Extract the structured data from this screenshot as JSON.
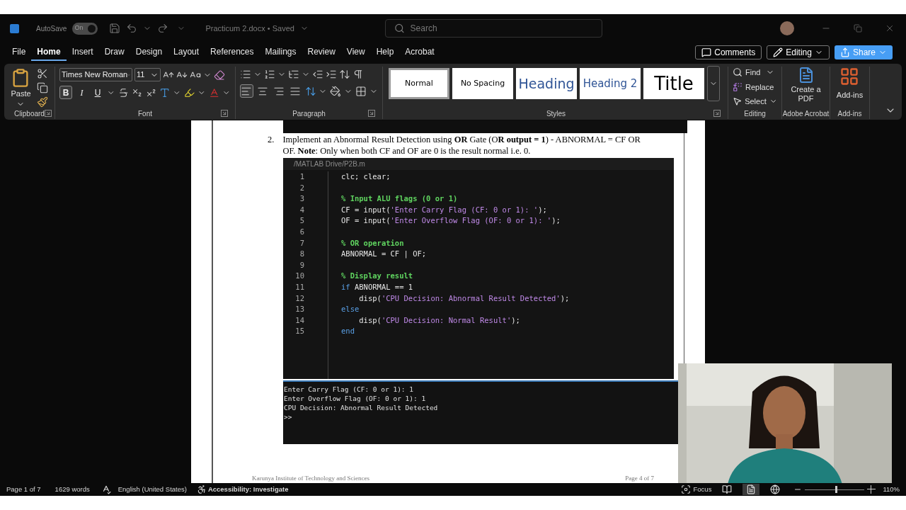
{
  "title_bar": {
    "autosave_label": "AutoSave",
    "autosave_on": true,
    "autosave_state": "On",
    "document_title": "Practicum 2.docx • Saved",
    "search_placeholder": "Search"
  },
  "tabs": [
    {
      "label": "File",
      "selected": false
    },
    {
      "label": "Home",
      "selected": true
    },
    {
      "label": "Insert",
      "selected": false
    },
    {
      "label": "Draw",
      "selected": false
    },
    {
      "label": "Design",
      "selected": false
    },
    {
      "label": "Layout",
      "selected": false
    },
    {
      "label": "References",
      "selected": false
    },
    {
      "label": "Mailings",
      "selected": false
    },
    {
      "label": "Review",
      "selected": false
    },
    {
      "label": "View",
      "selected": false
    },
    {
      "label": "Help",
      "selected": false
    },
    {
      "label": "Acrobat",
      "selected": false
    }
  ],
  "header_buttons": {
    "comments": "Comments",
    "editing": "Editing",
    "share": "Share"
  },
  "ribbon": {
    "clipboard": {
      "paste": "Paste",
      "label": "Clipboard"
    },
    "font": {
      "name": "Times New Roman",
      "size": "11",
      "label": "Font",
      "format": [
        {
          "label": "B",
          "selected": true
        },
        {
          "label": "I",
          "selected": false
        },
        {
          "label": "U",
          "selected": false
        }
      ]
    },
    "paragraph": {
      "label": "Paragraph",
      "alignment": [
        {
          "selected": true
        },
        {
          "selected": false
        },
        {
          "selected": false
        },
        {
          "selected": false
        }
      ]
    },
    "styles": {
      "label": "Styles",
      "items": [
        {
          "label": "Normal",
          "kind": "normal",
          "selected": true
        },
        {
          "label": "No Spacing",
          "kind": "normal",
          "selected": false
        },
        {
          "label": "Heading",
          "kind": "heading",
          "selected": false
        },
        {
          "label": "Heading 2",
          "kind": "heading2",
          "selected": false
        },
        {
          "label": "Title",
          "kind": "title",
          "selected": false
        }
      ]
    },
    "editing": {
      "find": "Find",
      "replace": "Replace",
      "select": "Select",
      "label": "Editing"
    },
    "acrobat": {
      "button": "Create a PDF",
      "label": "Adobe Acrobat"
    },
    "addins": {
      "button": "Add-ins",
      "label": "Add-ins"
    }
  },
  "document": {
    "list_number": "2.",
    "paragraph": "Implement an Abnormal Result Detection using **OR** Gate (O**R output = 1**) - ABNORMAL = CF OR OF. **Note**: Only when both CF and OF are 0 is the result normal i.e. 0.",
    "editor": {
      "path": "/MATLAB Drive/P2B.m",
      "lines": [
        {
          "number": "1",
          "segments": [
            {
              "kind": "plain",
              "text": "clc; clear;"
            }
          ]
        },
        {
          "number": "2"
        },
        {
          "number": "3",
          "segments": [
            {
              "kind": "comment",
              "text": "% Input ALU flags (0 or 1)"
            }
          ]
        },
        {
          "number": "4",
          "segments": [
            {
              "kind": "plain",
              "text": "CF = input("
            },
            {
              "kind": "string",
              "text": "'Enter Carry Flag (CF: 0 or 1): '"
            },
            {
              "kind": "plain",
              "text": ");"
            }
          ]
        },
        {
          "number": "5",
          "segments": [
            {
              "kind": "plain",
              "text": "OF = input("
            },
            {
              "kind": "string",
              "text": "'Enter Overflow Flag (OF: 0 or 1): '"
            },
            {
              "kind": "plain",
              "text": ");"
            }
          ]
        },
        {
          "number": "6"
        },
        {
          "number": "7",
          "segments": [
            {
              "kind": "comment",
              "text": "% OR operation"
            }
          ]
        },
        {
          "number": "8",
          "segments": [
            {
              "kind": "plain",
              "text": "ABNORMAL = CF | OF;"
            }
          ]
        },
        {
          "number": "9"
        },
        {
          "number": "10",
          "segments": [
            {
              "kind": "comment",
              "text": "% Display result"
            }
          ]
        },
        {
          "number": "11",
          "segments": [
            {
              "kind": "keyword",
              "text": "if"
            },
            {
              "kind": "plain",
              "text": " ABNORMAL == 1"
            }
          ]
        },
        {
          "number": "12",
          "segments": [
            {
              "kind": "plain",
              "text": "    disp("
            },
            {
              "kind": "string",
              "text": "'CPU Decision: Abnormal Result Detected'"
            },
            {
              "kind": "plain",
              "text": ");"
            }
          ]
        },
        {
          "number": "13",
          "segments": [
            {
              "kind": "keyword",
              "text": "else"
            }
          ]
        },
        {
          "number": "14",
          "segments": [
            {
              "kind": "plain",
              "text": "    disp("
            },
            {
              "kind": "string",
              "text": "'CPU Decision: Normal Result'"
            },
            {
              "kind": "plain",
              "text": ");"
            }
          ]
        },
        {
          "number": "15",
          "segments": [
            {
              "kind": "keyword",
              "text": "end"
            }
          ]
        }
      ]
    },
    "console": [
      "Enter Carry Flag (CF: 0 or 1): 1",
      "Enter Overflow Flag (OF: 0 or 1): 1",
      "CPU Decision: Abnormal Result Detected",
      ">>"
    ],
    "footer_left": "Karunya Institute of Technology and Sciences",
    "footer_right": "Page 4 of 7"
  },
  "status_bar": {
    "page": "Page 1 of 7",
    "words": "1629 words",
    "language": "English (United States)",
    "accessibility": "Accessibility: Investigate",
    "focus": "Focus",
    "views": [
      {
        "selected": false
      },
      {
        "selected": true
      },
      {
        "selected": false
      }
    ],
    "zoom": {
      "level": 0.52,
      "reading": "110%"
    }
  }
}
